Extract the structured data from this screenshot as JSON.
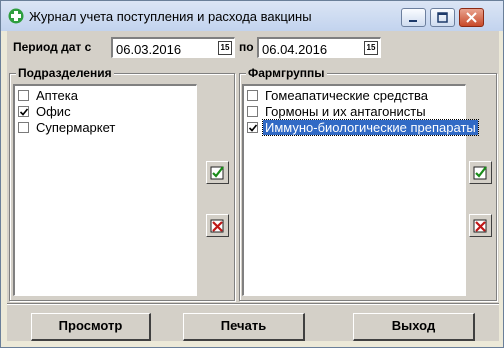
{
  "window": {
    "title": "Журнал учета поступления и расхода вакцины"
  },
  "period": {
    "label_from": "Период дат с",
    "date_from": "06.03.2016",
    "label_to": "по",
    "date_to": "06.04.2016",
    "calendar_glyph": "15"
  },
  "subdivisions": {
    "title": "Подразделения",
    "items": [
      {
        "label": "Аптека",
        "checked": false
      },
      {
        "label": "Офис",
        "checked": true
      },
      {
        "label": "Супермаркет",
        "checked": false
      }
    ]
  },
  "pharmgroups": {
    "title": "Фармгруппы",
    "items": [
      {
        "label": "Гомеапатические средства",
        "checked": false
      },
      {
        "label": "Гормоны и их антагонисты",
        "checked": false
      },
      {
        "label": "Иммуно-биологические препараты",
        "checked": true,
        "selected": true
      }
    ]
  },
  "buttons": {
    "view": "Просмотр",
    "print": "Печать",
    "exit": "Выход"
  },
  "colors": {
    "selection": "#316ac5",
    "face": "#d4d0c8",
    "titlebar": "#c2d3ee"
  }
}
